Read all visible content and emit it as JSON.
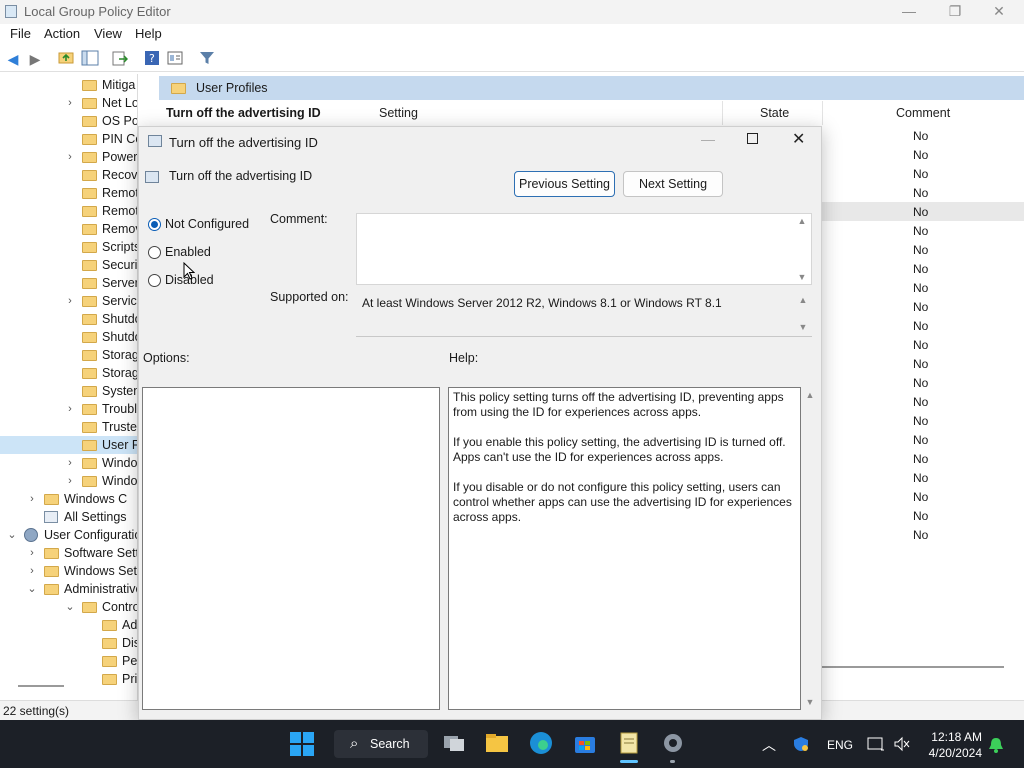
{
  "window": {
    "title": "Local Group Policy Editor",
    "controls": {
      "minimize": "—",
      "maximize": "❐",
      "close": "✕"
    }
  },
  "menu": [
    "File",
    "Action",
    "View",
    "Help"
  ],
  "tree": {
    "items": [
      {
        "label": "Mitiga",
        "chev": ""
      },
      {
        "label": "Net Lo",
        "chev": "›"
      },
      {
        "label": "OS Pol",
        "chev": ""
      },
      {
        "label": "PIN Co",
        "chev": ""
      },
      {
        "label": "Power",
        "chev": "›"
      },
      {
        "label": "Recove",
        "chev": ""
      },
      {
        "label": "Remot",
        "chev": ""
      },
      {
        "label": "Remot",
        "chev": ""
      },
      {
        "label": "Remov",
        "chev": ""
      },
      {
        "label": "Scripts",
        "chev": ""
      },
      {
        "label": "Securit",
        "chev": ""
      },
      {
        "label": "Server",
        "chev": ""
      },
      {
        "label": "Service",
        "chev": "›"
      },
      {
        "label": "Shutdo",
        "chev": ""
      },
      {
        "label": "Shutdo",
        "chev": ""
      },
      {
        "label": "Storag",
        "chev": ""
      },
      {
        "label": "Storag",
        "chev": ""
      },
      {
        "label": "System",
        "chev": ""
      },
      {
        "label": "Troubl",
        "chev": "›"
      },
      {
        "label": "Trusted",
        "chev": ""
      },
      {
        "label": "User Pr",
        "chev": ""
      },
      {
        "label": "Windo",
        "chev": "›"
      },
      {
        "label": "Windo",
        "chev": "›"
      }
    ],
    "windows_components": "Windows C",
    "all_settings": "All Settings",
    "user_configuration": "User Configuration",
    "software_settings": "Software Setti",
    "windows_settings": "Windows Sett",
    "administrative": "Administrative",
    "control_panel": "Control Pa",
    "add_or": "Add or",
    "display": "Display",
    "personalization": "Person",
    "printers": "Printe"
  },
  "list": {
    "header_title": "User Profiles",
    "setting_name": "Turn off the advertising ID",
    "col_setting": "Setting",
    "col_state": "State",
    "col_comment": "Comment",
    "comment_values": [
      "No",
      "No",
      "No",
      "No",
      "No",
      "No",
      "No",
      "No",
      "No",
      "No",
      "No",
      "No",
      "No",
      "No",
      "No",
      "No",
      "No",
      "No",
      "No",
      "No",
      "No",
      "No"
    ]
  },
  "status": {
    "text": "22 setting(s)"
  },
  "dialog": {
    "title": "Turn off the advertising ID",
    "policy_name": "Turn off the advertising ID",
    "prev_button": "Previous Setting",
    "next_button": "Next Setting",
    "radio_not_configured": "Not Configured",
    "radio_enabled": "Enabled",
    "radio_disabled": "Disabled",
    "comment_label": "Comment:",
    "supported_label": "Supported on:",
    "supported_value": "At least Windows Server 2012 R2, Windows 8.1 or Windows RT 8.1",
    "options_label": "Options:",
    "help_label": "Help:",
    "help_p1": "This policy setting turns off the advertising ID, preventing apps from using the ID for experiences across apps.",
    "help_p2": "If you enable this policy setting, the advertising ID is turned off. Apps can't use the ID for experiences across apps.",
    "help_p3": "If you disable or do not configure this policy setting, users can control whether apps can use the advertising ID for experiences across apps.",
    "selected_option": "Not Configured"
  },
  "taskbar": {
    "search_label": "Search",
    "tray_lang": "ENG",
    "time": "12:18 AM",
    "date": "4/20/2024"
  },
  "colors": {
    "accent": "#0a5db6",
    "list_header": "#c5d9ee",
    "taskbar": "#1c2027"
  }
}
